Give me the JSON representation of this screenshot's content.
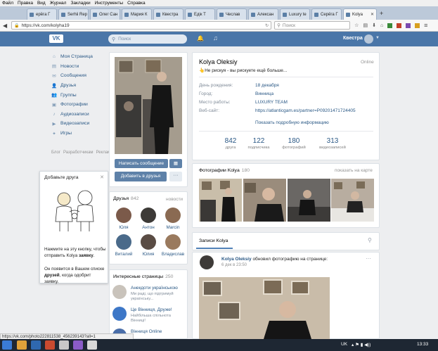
{
  "browser": {
    "menu": [
      "Файл",
      "Правка",
      "Вид",
      "Журнал",
      "Закладки",
      "Инструменты",
      "Справка"
    ],
    "tabs": [
      {
        "label": "ерёга Г"
      },
      {
        "label": "Serhii Rep"
      },
      {
        "label": "Олег Сан"
      },
      {
        "label": "Мария К"
      },
      {
        "label": "Квестра"
      },
      {
        "label": "Едік Т"
      },
      {
        "label": "Чеслав"
      },
      {
        "label": "Алексан"
      },
      {
        "label": "Luxury te"
      },
      {
        "label": "Серёга Г"
      },
      {
        "label": "Kolya"
      }
    ],
    "new_tab": "+",
    "url": "https://vk.com/kolyha19",
    "search_placeholder": "Поиск",
    "status_url": "https://vk.com/photo222811538_456239143?all=1"
  },
  "vk": {
    "logo": "VK",
    "search_placeholder": "Поиск",
    "user_name": "Квестра",
    "left_menu": [
      {
        "icon": "home-icon",
        "glyph": "⌂",
        "label": "Моя Страница"
      },
      {
        "icon": "news-icon",
        "glyph": "▤",
        "label": "Новости"
      },
      {
        "icon": "messages-icon",
        "glyph": "✉",
        "label": "Сообщения"
      },
      {
        "icon": "friends-icon",
        "glyph": "👤",
        "label": "Друзья"
      },
      {
        "icon": "groups-icon",
        "glyph": "👥",
        "label": "Группы"
      },
      {
        "icon": "photos-icon",
        "glyph": "▣",
        "label": "Фотографии"
      },
      {
        "icon": "audio-icon",
        "glyph": "♪",
        "label": "Аудиозаписи"
      },
      {
        "icon": "video-icon",
        "glyph": "▶",
        "label": "Видеозаписи"
      },
      {
        "icon": "games-icon",
        "glyph": "✦",
        "label": "Игры"
      }
    ],
    "footer_links": [
      "Блог",
      "Разработчикам",
      "Реклама",
      "Ещё"
    ],
    "add_friend_popup": {
      "title": "Добавьте друга",
      "text1_pre": "Нажмите на эту кнопку, чтобы отправить Kolya ",
      "text1_bold": "заявку",
      "text1_post": ".",
      "text2_pre": "Он появится в Вашем списке ",
      "text2_bold": "друзей",
      "text2_post": ", когда одобрит заявку."
    }
  },
  "profile": {
    "name": "Kolya Oleksiy",
    "status": "👆Не рискуя - вы рискуете ещё больше...",
    "online": "Online",
    "info": [
      {
        "label": "День рождения:",
        "value": "18 декабря"
      },
      {
        "label": "Город:",
        "value": "Винница"
      },
      {
        "label": "Место работы:",
        "value": "LUXURY TEAM"
      },
      {
        "label": "Веб-сайт:",
        "value": "https://atlanticgam.es/partner=P09201471724405"
      }
    ],
    "more_info": "Показать подробную информацию",
    "counters": [
      {
        "num": "842",
        "label": "друга"
      },
      {
        "num": "122",
        "label": "подписчика"
      },
      {
        "num": "180",
        "label": "фотографий"
      },
      {
        "num": "313",
        "label": "видеозаписей"
      }
    ],
    "write_message": "Написать сообщение",
    "add_to_friends": "Добавить в друзья",
    "more": "···"
  },
  "friends": {
    "title": "Друзья",
    "count": "842",
    "link": "новости",
    "list": [
      {
        "name": "Юля"
      },
      {
        "name": "Антон"
      },
      {
        "name": "Marcin"
      },
      {
        "name": "Виталий"
      },
      {
        "name": "Юлия"
      },
      {
        "name": "Владислав"
      }
    ]
  },
  "interesting_pages": {
    "title": "Интересные страницы",
    "count": "250",
    "list": [
      {
        "name": "Анекдоти українською",
        "desc": "Ми раді, що підтримуй українську..."
      },
      {
        "name": "Це Вінниця, Друже!",
        "desc": "Найбільша спільнота Вінниці!"
      },
      {
        "name": "Вінниця Online",
        "desc": ""
      }
    ]
  },
  "photos": {
    "title": "Фотографии Kolya",
    "count": "180",
    "link": "показать на карте"
  },
  "wall": {
    "tab": "Записи Kolya",
    "author": "Kolya Oleksiy",
    "action": " обновил фотографию на странице:",
    "date": "6 дек в 23:50",
    "menu": "···"
  },
  "taskbar": {
    "lang": "UK",
    "time": "13:33"
  },
  "colors": {
    "vk_blue": "#4a76a8",
    "link": "#2a5885",
    "button": "#5e81a8",
    "background": "#edeef0"
  }
}
